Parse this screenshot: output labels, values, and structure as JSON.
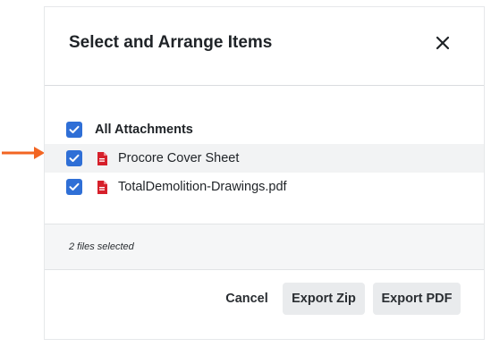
{
  "modal": {
    "title": "Select and Arrange Items"
  },
  "list": {
    "all_label": "All Attachments",
    "items": [
      {
        "label": "Procore Cover Sheet",
        "checked": true,
        "icon": "pdf-file-icon"
      },
      {
        "label": "TotalDemolition-Drawings.pdf",
        "checked": true,
        "icon": "pdf-file-icon"
      }
    ]
  },
  "footer": {
    "selection_status": "2 files selected"
  },
  "actions": {
    "cancel_label": "Cancel",
    "export_zip_label": "Export Zip",
    "export_pdf_label": "Export PDF"
  },
  "colors": {
    "checkbox": "#2f6fd6",
    "arrow": "#f26522",
    "pdf_icon": "#d6202b",
    "button_bg": "#e9ebed"
  }
}
